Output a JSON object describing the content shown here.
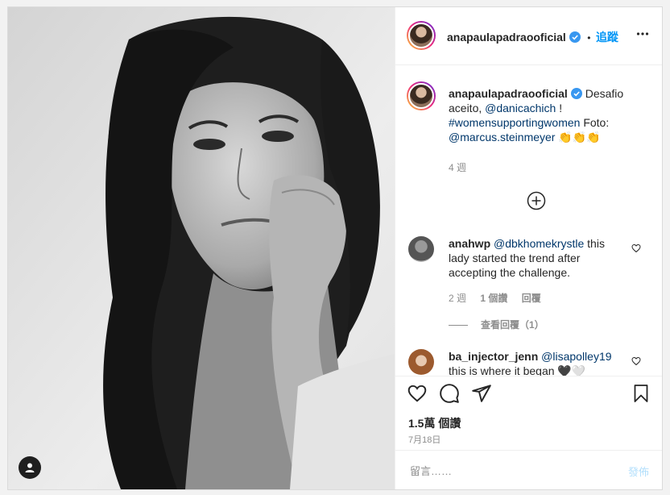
{
  "header": {
    "username": "anapaulapadraooficial",
    "separator": "•",
    "follow_label": "追蹤"
  },
  "caption": {
    "username": "anapaulapadraooficial",
    "text_1": "Desafio aceito,",
    "mention_1": "@danicachich",
    "text_2": "!",
    "hashtag": "#womensupportingwomen",
    "text_3": "Foto:",
    "mention_2": "@marcus.steinmeyer",
    "emoji": "👏👏👏",
    "time": "4 週"
  },
  "load_more_icon": "plus-circle-icon",
  "comments": [
    {
      "username": "anahwp",
      "mention": "@dbkhomekrystle",
      "text": "this lady started the trend after accepting the challenge.",
      "time": "2 週",
      "likes": "1 個讚",
      "reply": "回覆",
      "view_replies": "查看回覆（1）"
    },
    {
      "username": "ba_injector_jenn",
      "mention": "@lisapolley19",
      "text": "this is where it began 🖤🤍"
    }
  ],
  "stats": {
    "likes": "1.5萬 個讚",
    "date": "7月18日"
  },
  "comment_box": {
    "placeholder": "留言……",
    "post_label": "發佈"
  },
  "colors": {
    "accent": "#0095f6",
    "link": "#00376b",
    "muted": "#8e8e8e",
    "post_disabled": "#b2dffc"
  }
}
